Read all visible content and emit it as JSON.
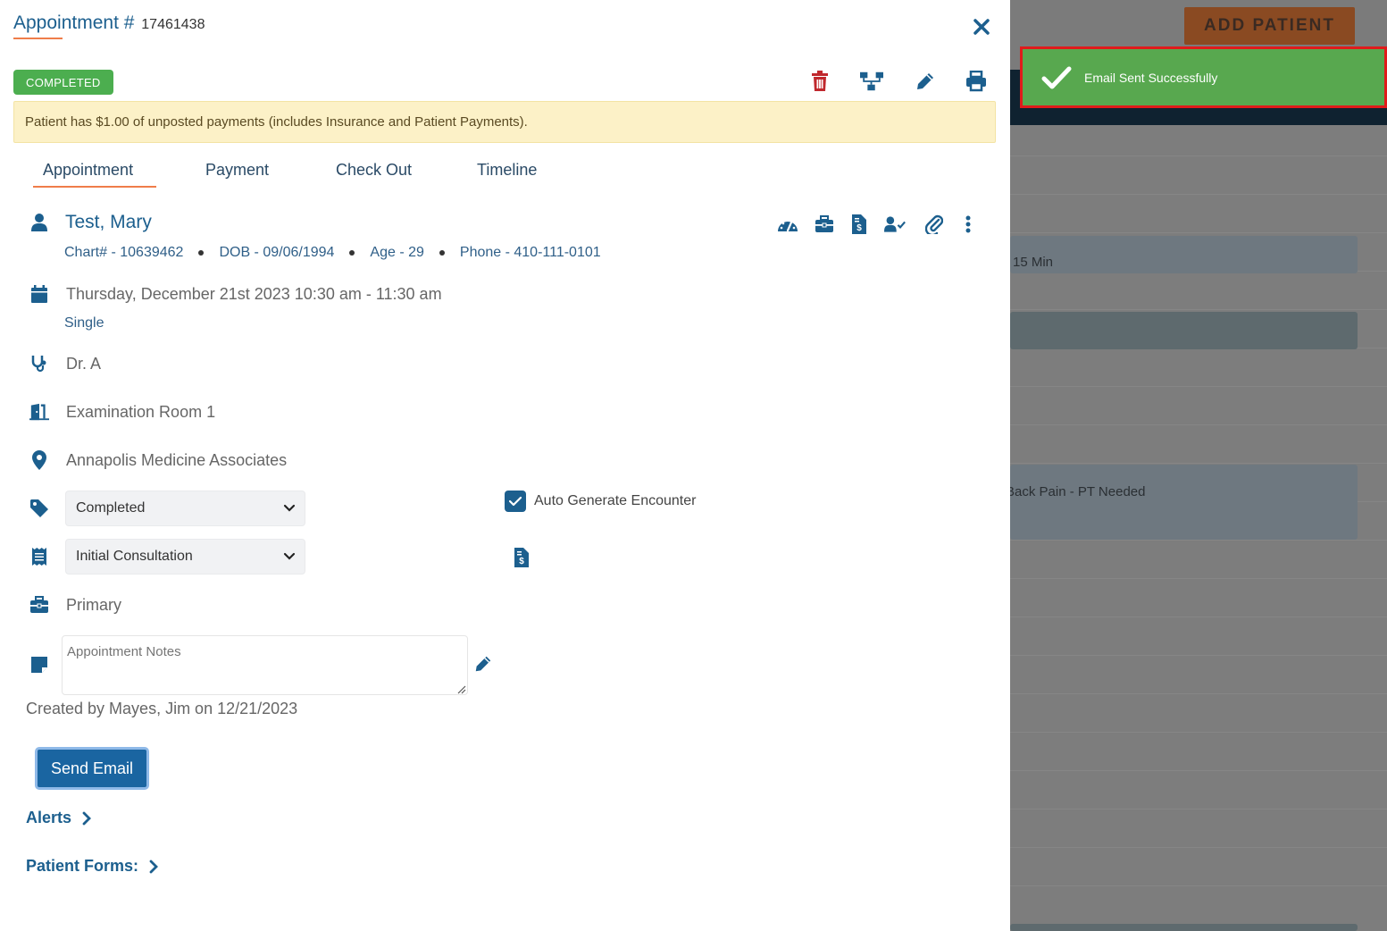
{
  "background": {
    "add_patient_label": "ADD PATIENT",
    "slot_duration": "15 Min",
    "appointment_reason": "Back Pain - PT Needed",
    "appointment_reason_prefix_hidden": "B"
  },
  "toast": {
    "message": "Email Sent Successfully",
    "icon": "check-icon",
    "color": "#58a84f",
    "highlight_border_color": "#e01b1b"
  },
  "header": {
    "title": "Appointment #",
    "appointment_number": "17461438",
    "close_icon": "close-icon"
  },
  "status_badge": {
    "label": "COMPLETED",
    "color": "#4cae4f"
  },
  "toolbar": {
    "icons": [
      "trash-icon",
      "hierarchy-icon",
      "pencil-icon",
      "print-icon"
    ]
  },
  "notice": {
    "text": "Patient has $1.00 of unposted payments (includes Insurance and Patient Payments)."
  },
  "tabs": [
    {
      "label": "Appointment",
      "active": true
    },
    {
      "label": "Payment",
      "active": false
    },
    {
      "label": "Check Out",
      "active": false
    },
    {
      "label": "Timeline",
      "active": false
    }
  ],
  "patient": {
    "name": "Test, Mary",
    "chart": "Chart# - 10639462",
    "dob": "DOB - 09/06/1994",
    "age": "Age - 29",
    "phone": "Phone - 410-111-0101",
    "action_icons": [
      "dashboard-icon",
      "briefcase-icon",
      "invoice-icon",
      "user-check-icon",
      "paperclip-icon",
      "more-vertical-icon"
    ]
  },
  "appointment": {
    "datetime": "Thursday, December 21st 2023 10:30 am - 11:30 am",
    "recurrence": "Single",
    "provider": "Dr. A",
    "room": "Examination Room 1",
    "location": "Annapolis Medicine Associates",
    "status_select": "Completed",
    "type_select": "Initial Consultation",
    "auto_generate_label": "Auto Generate Encounter",
    "auto_generate_checked": true,
    "insurance": "Primary",
    "notes_placeholder": "Appointment Notes",
    "created_by": "Created by Mayes, Jim on 12/21/2023"
  },
  "actions": {
    "send_email": "Send Email",
    "alerts": "Alerts",
    "patient_forms": "Patient Forms:"
  },
  "colors": {
    "primary": "#1c5f8e",
    "accent_orange": "#ef7d4a",
    "danger": "#c0282d",
    "button_blue": "#1a65a1"
  }
}
